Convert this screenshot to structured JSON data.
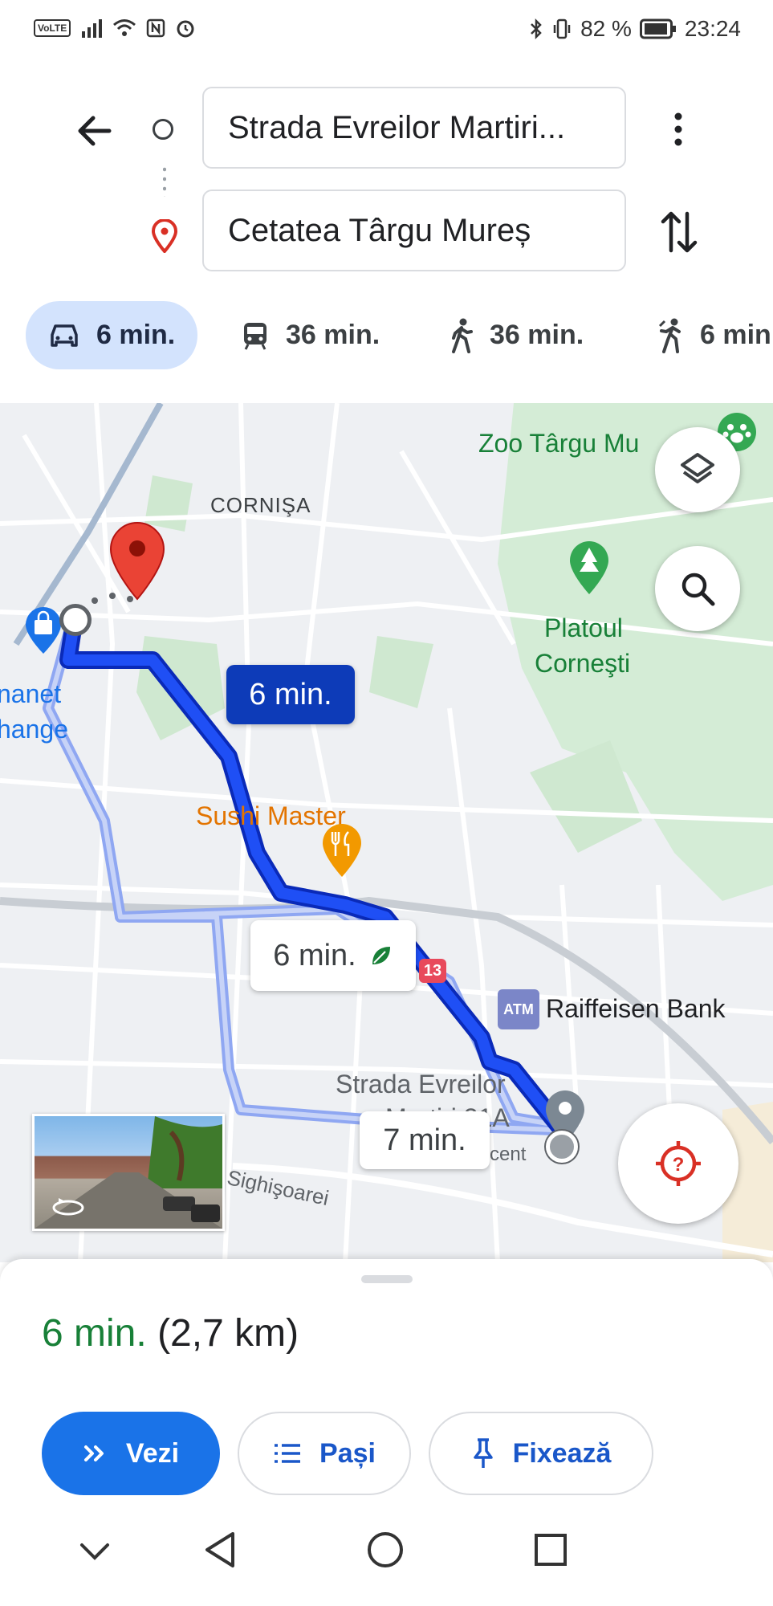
{
  "status_bar": {
    "carrier_badge": "VoLTE",
    "battery": "82 %",
    "time": "23:24"
  },
  "route": {
    "origin": "Strada Evreilor Martiri...",
    "destination": "Cetatea Târgu Mureș"
  },
  "modes": [
    {
      "icon": "car-icon",
      "label": "6 min."
    },
    {
      "icon": "transit-icon",
      "label": "36 min."
    },
    {
      "icon": "walk-icon",
      "label": "36 min."
    },
    {
      "icon": "ride-icon",
      "label": "6 min"
    }
  ],
  "map": {
    "labels": {
      "zoo": "Zoo Târgu Mu",
      "cornisa": "CORNIŞA",
      "platoul": "Platoul",
      "cornesti": "Corneşti",
      "manet": "nanet",
      "hange": "hange",
      "sushi": "Sushi Master",
      "raiffeisen": "Raiffeisen Bank",
      "strada1": "Strada Evreilor",
      "strada2": "Martiri 31A",
      "cent": "cent",
      "sighisoarei": "Sighişoarei",
      "route_badge": "13",
      "atm": "ATM"
    },
    "chips": {
      "main": "6 min.",
      "eco": "6 min.",
      "alt": "7 min."
    },
    "colors": {
      "route_main": "#1a3cf0",
      "route_alt": "#8fa7f2",
      "pin": "#ea4335",
      "park": "#cfe8d0"
    }
  },
  "sheet": {
    "duration": "6 min.",
    "distance": "(2,7 km)",
    "buttons": {
      "start": "Vezi",
      "steps": "Pași",
      "pin": "Fixează"
    }
  }
}
